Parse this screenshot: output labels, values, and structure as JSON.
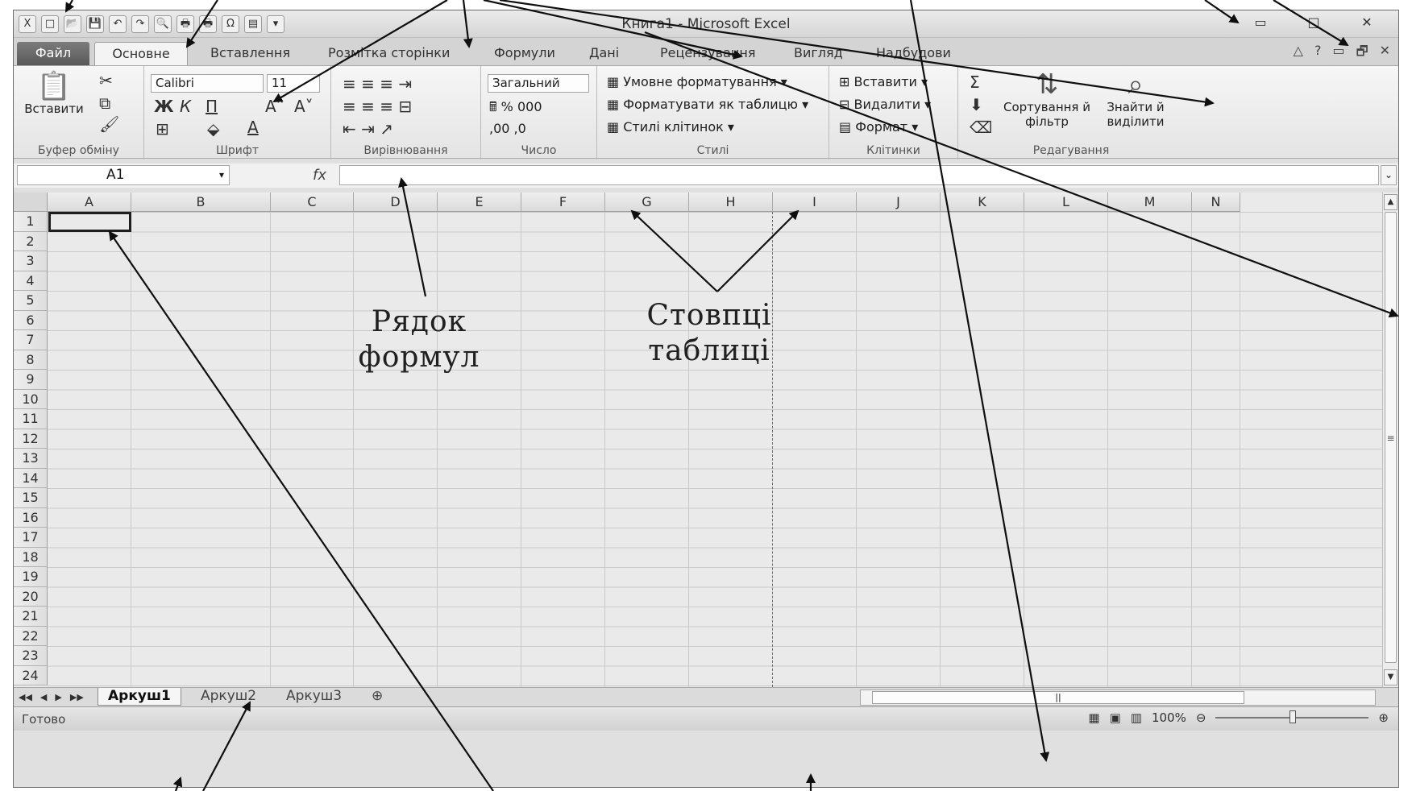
{
  "titlebar": {
    "title": "Книга1 - Microsoft Excel",
    "qat": [
      "X",
      "□",
      "📂",
      "💾",
      "↶",
      "↷",
      "🔍",
      "🖶",
      "🖶",
      "Ω",
      "▤",
      "▾"
    ],
    "window_controls": [
      "▭",
      "□",
      "✕"
    ]
  },
  "tabs": [
    "Файл",
    "Основне",
    "Вставлення",
    "Розмітка сторінки",
    "Формули",
    "Дані",
    "Рецензування",
    "Вигляд",
    "Надбудови"
  ],
  "tabs_right": [
    "△",
    "?",
    "▭",
    "🗗",
    "✕"
  ],
  "ribbon": {
    "clipboard": {
      "label": "Буфер обміну",
      "paste": "Вставити",
      "cut": "✂",
      "copy": "⧉",
      "painter": "🖌"
    },
    "font": {
      "label": "Шрифт",
      "font_name": "Calibri",
      "font_size": "11",
      "bold": "Ж",
      "italic": "К",
      "underline": "П",
      "grow": "A˄",
      "shrink": "A˅",
      "borders": "⊞",
      "fill": "⬙",
      "color": "A"
    },
    "alignment": {
      "label": "Вирівнювання",
      "row1": "≡ ≡ ≡ ⇥",
      "row2": "≡ ≡ ≡ ⊟",
      "row3": "⇤ ⇥   ↗"
    },
    "number": {
      "label": "Число",
      "format": "Загальний",
      "row2": "🖩 % 000",
      "row3": ",00 ,0"
    },
    "styles": {
      "label": "Стилі",
      "conditional": "Умовне форматування",
      "as_table": "Форматувати як таблицю",
      "cell_styles": "Стилі клітинок"
    },
    "cells": {
      "label": "Клітинки",
      "insert": "Вставити",
      "delete": "Видалити",
      "format": "Формат"
    },
    "editing": {
      "label": "Редагування",
      "sum": "Σ",
      "fill": "⬇",
      "clear": "⌫",
      "sort": "Сортування й фільтр",
      "find": "Знайти й виділити"
    }
  },
  "formula_bar": {
    "name_box": "A1",
    "fx": "fx",
    "value": ""
  },
  "columns": [
    "A",
    "B",
    "C",
    "D",
    "E",
    "F",
    "G",
    "H",
    "I",
    "J",
    "K",
    "L",
    "M",
    "N"
  ],
  "rows": [
    "1",
    "2",
    "3",
    "4",
    "5",
    "6",
    "7",
    "8",
    "9",
    "10",
    "11",
    "12",
    "13",
    "14",
    "15",
    "16",
    "17",
    "18",
    "19",
    "20",
    "21",
    "22",
    "23",
    "24"
  ],
  "sheets": [
    "Аркуш1",
    "Аркуш2",
    "Аркуш3"
  ],
  "status": {
    "ready": "Готово",
    "zoom": "100%"
  },
  "annotations": {
    "formula_label_1": "Рядок",
    "formula_label_2": "формул",
    "columns_label_1": "Стовпці",
    "columns_label_2": "таблиці"
  }
}
